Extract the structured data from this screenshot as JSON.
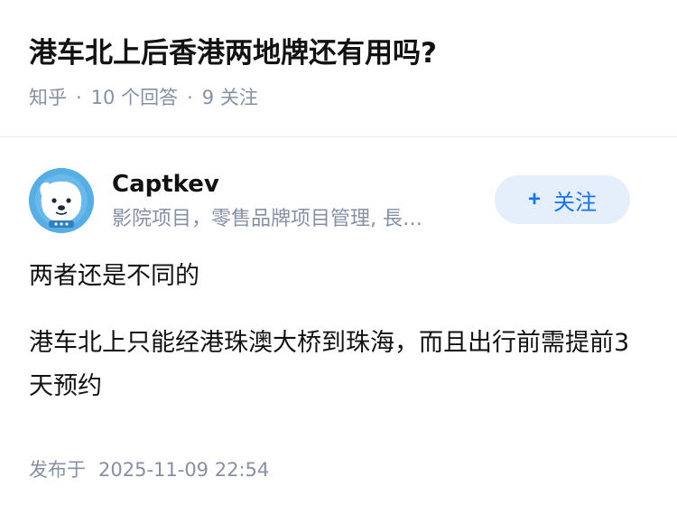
{
  "question": {
    "title": "港车北上后香港两地牌还有用吗?",
    "source": "知乎",
    "answers_count": "10",
    "answers_label": "个回答",
    "followers_count": "9",
    "followers_label": "关注"
  },
  "answer": {
    "author": {
      "name": "Captkev",
      "headline": "影院项目，零售品牌项目管理, 長…",
      "avatar_icon": "dog-avatar-icon"
    },
    "follow_button": {
      "icon": "plus-icon",
      "label": "关注"
    },
    "paragraphs": [
      "两者还是不同的",
      "港车北上只能经港珠澳大桥到珠海，而且出行前需提前3天预约"
    ],
    "published_label": "发布于",
    "published_time": "2025-11-09 22:54"
  },
  "colors": {
    "text": "#121212",
    "meta": "#8590a6",
    "accent": "#1772f6",
    "follow_bg": "#e5effc",
    "avatar_bg": "#56aee5"
  }
}
